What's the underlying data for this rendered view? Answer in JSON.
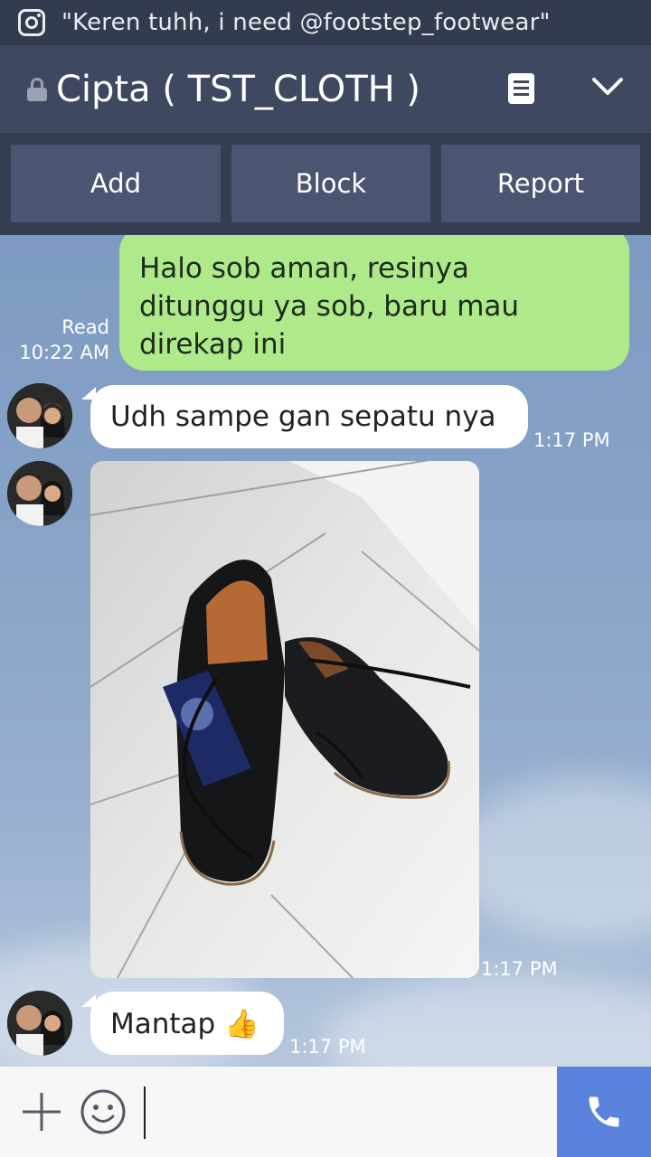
{
  "notification": {
    "icon": "instagram-icon",
    "text": "\"Keren tuhh, i need @footstep_footwear\""
  },
  "header": {
    "title": "Cipta ( TST_CLOTH )",
    "lock_icon": "lock-icon",
    "notes_icon": "notes-icon",
    "menu_icon": "chevron-down-icon"
  },
  "actions": {
    "add_label": "Add",
    "block_label": "Block",
    "report_label": "Report"
  },
  "messages": {
    "outgoing_1": {
      "text_line1": "Halo sob aman, resinya",
      "text_line2": "ditunggu ya sob, baru mau",
      "text_line3": "direkap ini",
      "status": "Read",
      "time": "10:22 AM"
    },
    "incoming_1": {
      "text": "Udh sampe gan sepatu nya",
      "time": "1:17 PM"
    },
    "incoming_photo": {
      "alt": "photo of black leather shoes with blue tag",
      "time": "1:17 PM"
    },
    "incoming_2": {
      "text": "Mantap 👍",
      "time": "1:17 PM"
    }
  },
  "input_bar": {
    "plus_icon": "plus-icon",
    "emoji_icon": "smiley-icon",
    "call_icon": "phone-icon",
    "value": ""
  },
  "colors": {
    "header": "#3e4860",
    "outgoing_bubble": "#aee98a",
    "incoming_bubble": "#ffffff",
    "call_button": "#5a83dd"
  }
}
